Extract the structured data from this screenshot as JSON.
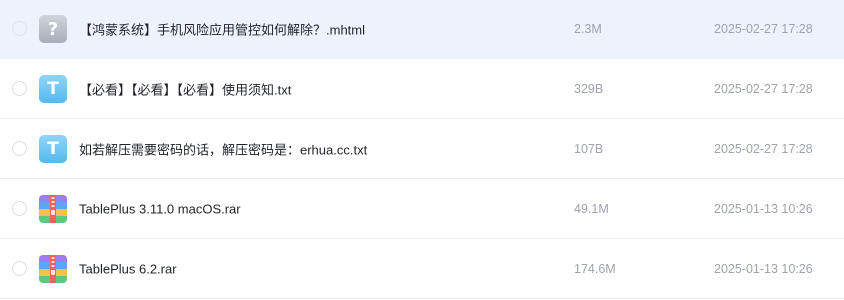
{
  "files": [
    {
      "name": "【鸿蒙系统】手机风险应用管控如何解除？.mhtml",
      "size": "2.3M",
      "date": "2025-02-27 17:28",
      "icon": "unknown-file-icon",
      "icon_glyph": "?"
    },
    {
      "name": "【必看】【必看】【必看】使用须知.txt",
      "size": "329B",
      "date": "2025-02-27 17:28",
      "icon": "text-file-icon",
      "icon_glyph": "T"
    },
    {
      "name": "如若解压需要密码的话，解压密码是：erhua.cc.txt",
      "size": "107B",
      "date": "2025-02-27 17:28",
      "icon": "text-file-icon",
      "icon_glyph": "T"
    },
    {
      "name": "TablePlus 3.11.0 macOS.rar",
      "size": "49.1M",
      "date": "2025-01-13 10:26",
      "icon": "archive-file-icon",
      "icon_glyph": ""
    },
    {
      "name": "TablePlus 6.2.rar",
      "size": "174.6M",
      "date": "2025-01-13 10:26",
      "icon": "archive-file-icon",
      "icon_glyph": ""
    }
  ],
  "colors": {
    "highlight_row": "#eef2fd",
    "text_primary": "#1f2329",
    "text_secondary": "#9ea3ab",
    "txt_icon": "#55b9ef",
    "unknown_icon": "#a9afba"
  }
}
